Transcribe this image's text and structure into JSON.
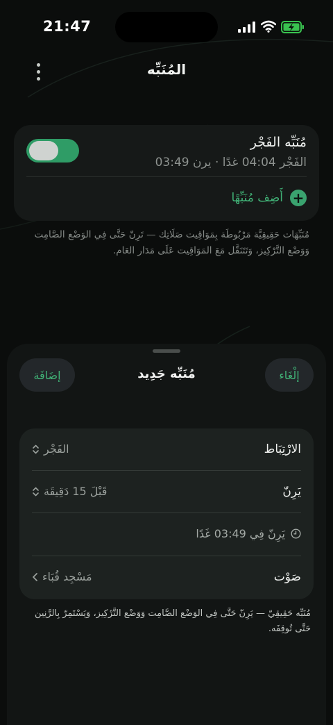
{
  "status_bar": {
    "time": "21:47"
  },
  "header": {
    "title": "المُنَبِّه",
    "menu_icon": "more-vertical-icon"
  },
  "alarm_card": {
    "title": "مُنَبِّه الفَجْر",
    "subtitle": "الفَجْر 04:04 غدًا · يرن 03:49",
    "enabled": true,
    "add_label": "أَضِف مُنَبِّهًا",
    "note": "مُنَبِّهَات حَقِيقِيَّة مَرْبُوطَة بِمَوَاقِيت صَلَاتِك — تَرِنّ حَتَّى فِي الوَضْع الصَّامِت وَوَضْع التَّرْكِيز، وَتَتَنَقَّل مَعَ المَوَاقِيت عَلَى مَدَار العَام."
  },
  "sheet": {
    "cancel_label": "إلْغَاء",
    "add_label": "إضَافَة",
    "title": "مُنَبِّه جَدِيد",
    "rows": [
      {
        "label": "الارْتِبَاط",
        "value": "الفَجْر"
      },
      {
        "label": "يَرِنّ",
        "value": "قَبْلَ 15 دَقِيقَة"
      },
      {
        "preview": "يَرِنّ فِي 03:49 غَدًا"
      },
      {
        "label": "صَوْت",
        "value": "مَسْجِد قُبَاء"
      }
    ],
    "note": "مُنَبِّه حَقِيقِيّ — يَرِنّ حَتَّى فِي الوَضْع الصَّامِت وَوَضْع التَّرْكِيز، وَيَسْتَمِرّ بِالرَّنِين حَتَّى تُوقِفَه."
  },
  "colors": {
    "accent": "#41b377",
    "toggle_on": "#2f9c66",
    "background": "#0b0d0c"
  }
}
